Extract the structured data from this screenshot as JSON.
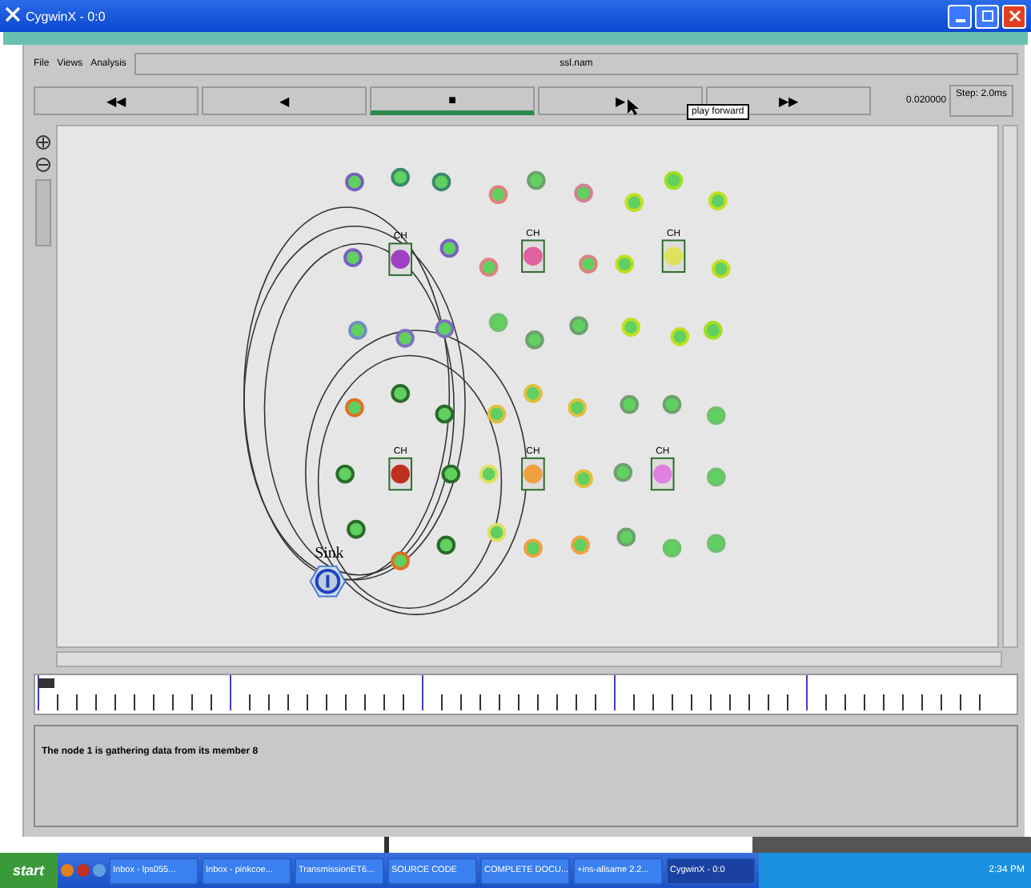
{
  "window": {
    "title": "CygwinX - 0:0"
  },
  "menu": [
    "File",
    "Views",
    "Analysis"
  ],
  "file_name": "ssl.nam",
  "controls": [
    {
      "label": "◀◀",
      "selected": false
    },
    {
      "label": "◀",
      "selected": false
    },
    {
      "label": "■",
      "selected": true
    },
    {
      "label": "▶",
      "selected": false
    },
    {
      "label": "▶▶",
      "selected": false
    }
  ],
  "tooltip": "play forward",
  "time": "0.020000",
  "step": "Step: 2.0ms",
  "nodes": [
    {
      "kind": "sensor",
      "color": "#7a60c0"
    },
    {
      "kind": "sensor",
      "color": "#3a8a6a"
    },
    {
      "kind": "sensor",
      "color": "#3a8a6a"
    },
    {
      "kind": "sensor",
      "color": "#e08080"
    },
    {
      "kind": "sensor",
      "color": "#70a070"
    },
    {
      "kind": "sensor",
      "color": "#d08090"
    },
    {
      "kind": "sensor",
      "color": "#c0e020"
    },
    {
      "kind": "sensor",
      "color": "#a0e020"
    },
    {
      "kind": "sensor",
      "color": "#c0e020"
    },
    {
      "kind": "sensor",
      "color": "#7a60c0"
    },
    {
      "kind": "cluster-head",
      "color": "#a040c0",
      "label": "CH"
    },
    {
      "kind": "sensor",
      "color": "#7a60c0"
    },
    {
      "kind": "sensor",
      "color": "#e08080"
    },
    {
      "kind": "cluster-head",
      "color": "#e060a0",
      "label": "CH"
    },
    {
      "kind": "sensor",
      "color": "#e08080"
    },
    {
      "kind": "sensor",
      "color": "#c0e020"
    },
    {
      "kind": "cluster-head",
      "color": "#e0e060",
      "label": "CH"
    },
    {
      "kind": "sensor",
      "color": "#c0e020"
    },
    {
      "kind": "sensor",
      "color": "#7090c0"
    },
    {
      "kind": "sensor",
      "color": "#8070c0"
    },
    {
      "kind": "sensor",
      "color": "#8070c0"
    },
    {
      "kind": "sensor",
      "color": "#70c070"
    },
    {
      "kind": "sensor",
      "color": "#70a070"
    },
    {
      "kind": "sensor",
      "color": "#70a070"
    },
    {
      "kind": "sensor",
      "color": "#c0e020"
    },
    {
      "kind": "sensor",
      "color": "#c0e020"
    },
    {
      "kind": "sensor",
      "color": "#a0e020"
    },
    {
      "kind": "sensor",
      "color": "#e07020"
    },
    {
      "kind": "sensor",
      "color": "#2a6a2a"
    },
    {
      "kind": "sensor",
      "color": "#2a6a2a"
    },
    {
      "kind": "sensor",
      "color": "#e0c040"
    },
    {
      "kind": "sensor",
      "color": "#e0c040"
    },
    {
      "kind": "sensor",
      "color": "#e0c040"
    },
    {
      "kind": "sensor",
      "color": "#70a070"
    },
    {
      "kind": "sensor",
      "color": "#70a070"
    },
    {
      "kind": "sensor",
      "color": "#70c070"
    },
    {
      "kind": "sensor",
      "color": "#2a6a2a"
    },
    {
      "kind": "cluster-head",
      "color": "#c03020",
      "label": "CH"
    },
    {
      "kind": "sensor",
      "color": "#2a6a2a"
    },
    {
      "kind": "sensor",
      "color": "#e0e060"
    },
    {
      "kind": "cluster-head",
      "color": "#f0a040",
      "label": "CH"
    },
    {
      "kind": "sensor",
      "color": "#e0c040"
    },
    {
      "kind": "sensor",
      "color": "#70a070"
    },
    {
      "kind": "cluster-head",
      "color": "#e080e0",
      "label": "CH"
    },
    {
      "kind": "sensor",
      "color": "#70c070"
    },
    {
      "kind": "sensor",
      "color": "#2a6a2a"
    },
    {
      "kind": "sensor",
      "color": "#e07020"
    },
    {
      "kind": "sensor",
      "color": "#2a6a2a"
    },
    {
      "kind": "sensor",
      "color": "#e0e060"
    },
    {
      "kind": "sensor",
      "color": "#f0a040"
    },
    {
      "kind": "sensor",
      "color": "#f0a040"
    },
    {
      "kind": "sensor",
      "color": "#70a070"
    },
    {
      "kind": "sensor",
      "color": "#70c070"
    },
    {
      "kind": "sensor",
      "color": "#70c070"
    },
    {
      "kind": "sink",
      "color": "#2040c0",
      "label": "Sink"
    }
  ],
  "message": "The node 1 is gathering data from its member 8",
  "taskbar": {
    "start": "start",
    "items": [
      {
        "label": "Inbox - lps055...",
        "selected": false
      },
      {
        "label": "Inbox - pinkcoe...",
        "selected": false
      },
      {
        "label": "TransmissionET6...",
        "selected": false
      },
      {
        "label": "SOURCE CODE",
        "selected": false
      },
      {
        "label": "COMPLETE DOCU...",
        "selected": false
      },
      {
        "label": "+ins-allsame 2.2...",
        "selected": false
      },
      {
        "label": "CygwinX - 0:0",
        "selected": true
      }
    ],
    "clock": "2:34 PM"
  }
}
